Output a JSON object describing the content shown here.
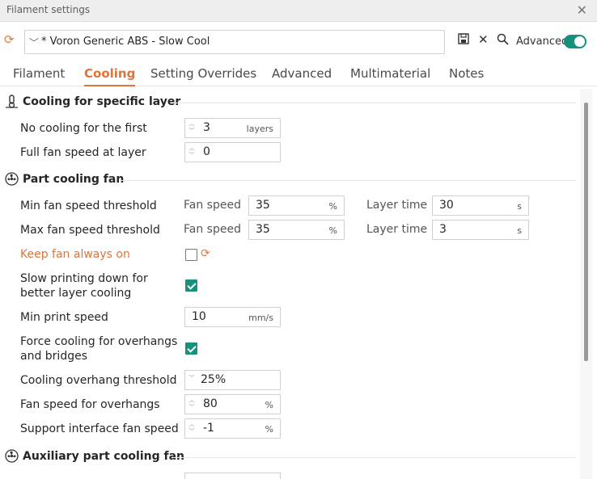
{
  "window": {
    "title": "Filament settings"
  },
  "preset": {
    "name": "* Voron Generic ABS - Slow Cool",
    "advanced_label": "Advanced",
    "advanced_on": true
  },
  "tabs": [
    {
      "label": "Filament",
      "active": false
    },
    {
      "label": "Cooling",
      "active": true
    },
    {
      "label": "Setting Overrides",
      "active": false
    },
    {
      "label": "Advanced",
      "active": false
    },
    {
      "label": "Multimaterial",
      "active": false
    },
    {
      "label": "Notes",
      "active": false
    }
  ],
  "sections": {
    "layer": "Cooling for specific layer",
    "part_fan": "Part cooling fan",
    "aux_fan": "Auxiliary part cooling fan"
  },
  "fields": {
    "no_cooling": {
      "label": "No cooling for the first",
      "value": "3",
      "unit": "layers"
    },
    "full_fan": {
      "label": "Full fan speed at layer",
      "value": "0"
    },
    "min_fan": {
      "label": "Min fan speed threshold",
      "fan_label": "Fan speed",
      "fan_value": "35",
      "fan_unit": "%",
      "time_label": "Layer time",
      "time_value": "30",
      "time_unit": "s"
    },
    "max_fan": {
      "label": "Max fan speed threshold",
      "fan_label": "Fan speed",
      "fan_value": "35",
      "fan_unit": "%",
      "time_label": "Layer time",
      "time_value": "3",
      "time_unit": "s"
    },
    "keep_fan": {
      "label": "Keep fan always on",
      "checked": false
    },
    "slow_down": {
      "label_line1": "Slow printing down for",
      "label_line2": "better layer cooling",
      "checked": true
    },
    "min_speed": {
      "label": "Min print speed",
      "value": "10",
      "unit": "mm/s"
    },
    "force_cool": {
      "label_line1": "Force cooling for overhangs",
      "label_line2": "and bridges",
      "checked": true
    },
    "overhang_thresh": {
      "label": "Cooling overhang threshold",
      "value": "25%"
    },
    "overhang_fan": {
      "label": "Fan speed for overhangs",
      "value": "80",
      "unit": "%"
    },
    "support_fan": {
      "label": "Support interface fan speed",
      "value": "-1",
      "unit": "%"
    }
  },
  "colors": {
    "accent": "#e0733a",
    "toggle": "#14907c",
    "check": "#1a907c"
  },
  "icons": {
    "refresh": "refresh-icon",
    "save": "save-icon",
    "close": "close-icon",
    "search": "search-icon",
    "layer": "thermometer-icon",
    "fan": "fan-icon"
  }
}
